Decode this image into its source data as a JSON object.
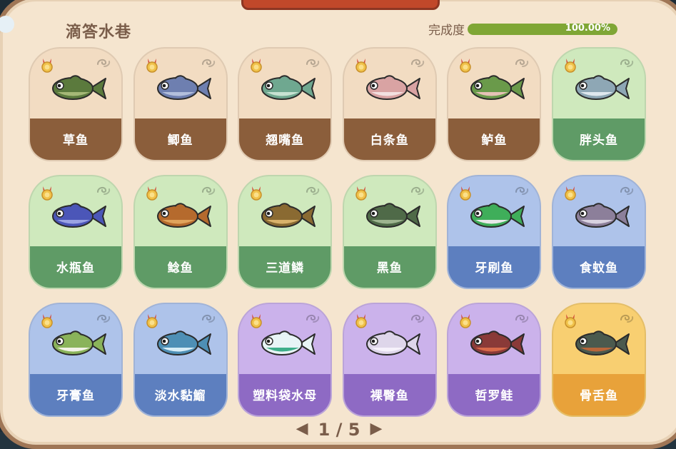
{
  "header": {
    "title": "滴答水巷",
    "completion_label": "完成度",
    "completion_value": "100.00%",
    "completion_fraction": 1.0
  },
  "pager": {
    "text": "1 / 5",
    "prev": "◀",
    "next": "▶"
  },
  "fish": [
    {
      "name": "草鱼",
      "theme": "brown",
      "icon": "grass-carp-icon",
      "body": "#5b7a3d",
      "belly": "#a5b877"
    },
    {
      "name": "鲫鱼",
      "theme": "brown",
      "icon": "crucian-carp-icon",
      "body": "#6e7fb0",
      "belly": "#b3bfdc"
    },
    {
      "name": "翘嘴鱼",
      "theme": "brown",
      "icon": "topmouth-culter-icon",
      "body": "#6fa890",
      "belly": "#c7e2d2"
    },
    {
      "name": "白条鱼",
      "theme": "brown",
      "icon": "sharpbelly-icon",
      "body": "#d9a3a3",
      "belly": "#f2e0e0"
    },
    {
      "name": "鲈鱼",
      "theme": "brown",
      "icon": "perch-icon",
      "body": "#6a9a4a",
      "belly": "#e6c2b6"
    },
    {
      "name": "胖头鱼",
      "theme": "green",
      "icon": "bighead-carp-icon",
      "body": "#8ea7b5",
      "belly": "#dfe8ee"
    },
    {
      "name": "水瓶鱼",
      "theme": "green",
      "icon": "bottle-fish-icon",
      "body": "#4b56b8",
      "belly": "#9aa3e3"
    },
    {
      "name": "鲶鱼",
      "theme": "green",
      "icon": "catfish-icon",
      "body": "#b56a2d",
      "belly": "#e0a35c"
    },
    {
      "name": "三道鳞",
      "theme": "green",
      "icon": "mirror-carp-icon",
      "body": "#8a6a32",
      "belly": "#d9b26b"
    },
    {
      "name": "黑鱼",
      "theme": "green",
      "icon": "snakehead-icon",
      "body": "#4f6a48",
      "belly": "#9db48f"
    },
    {
      "name": "牙刷鱼",
      "theme": "blue",
      "icon": "toothbrush-fish-icon",
      "body": "#3fae5a",
      "belly": "#e8e8e8"
    },
    {
      "name": "食蚊鱼",
      "theme": "blue",
      "icon": "mosquitofish-icon",
      "body": "#8c7f9a",
      "belly": "#d8d2e0"
    },
    {
      "name": "牙膏鱼",
      "theme": "blue",
      "icon": "toothpaste-fish-icon",
      "body": "#8ab35a",
      "belly": "#f2f2e6"
    },
    {
      "name": "淡水黏鰡",
      "theme": "blue",
      "icon": "freshwater-fish-icon",
      "body": "#4e8fb5",
      "belly": "#d7ecf5"
    },
    {
      "name": "塑料袋水母",
      "theme": "purple",
      "icon": "plastic-bag-jellyfish-icon",
      "body": "#e8f4f6",
      "belly": "#3fae8a"
    },
    {
      "name": "裸臀鱼",
      "theme": "purple",
      "icon": "naked-fish-icon",
      "body": "#ded6ea",
      "belly": "#f6f2fb"
    },
    {
      "name": "哲罗鲑",
      "theme": "purple",
      "icon": "taimen-icon",
      "body": "#8a3a38",
      "belly": "#d86a4a"
    },
    {
      "name": "骨舌鱼",
      "theme": "gold",
      "icon": "arowana-icon",
      "body": "#4b5a4e",
      "belly": "#b8663a"
    }
  ]
}
